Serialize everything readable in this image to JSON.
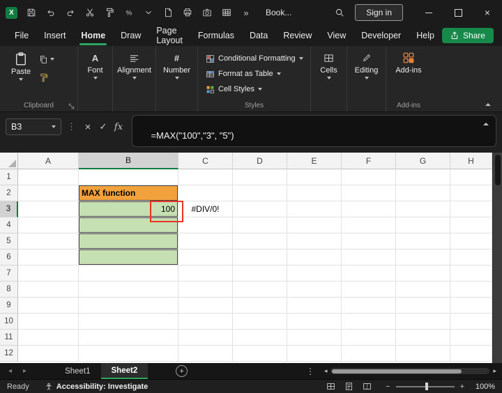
{
  "colors": {
    "accent_green": "#2EA561",
    "brand_green": "#107C41",
    "annotation_red": "#EA3323",
    "cell_orange": "#F2A23C",
    "cell_green": "#C6E0B4",
    "header_highlight": "#D2D2D2"
  },
  "titlebar": {
    "document_name": "Book...",
    "sign_in_label": "Sign in",
    "quick_access_icons": [
      "save",
      "undo",
      "redo",
      "cut",
      "format-painter",
      "percent",
      "chevron-down",
      "new-document",
      "print",
      "camera",
      "table",
      "overflow"
    ]
  },
  "menubar": {
    "items": [
      "File",
      "Insert",
      "Home",
      "Draw",
      "Page Layout",
      "Formulas",
      "Data",
      "Review",
      "View",
      "Developer",
      "Help"
    ],
    "active_item": "Home",
    "share_label": "Share"
  },
  "ribbon": {
    "paste_label": "Paste",
    "clipboard_group_label": "Clipboard",
    "font_label": "Font",
    "alignment_label": "Alignment",
    "number_label": "Number",
    "conditional_formatting_label": "Conditional Formatting",
    "format_as_table_label": "Format as Table",
    "cell_styles_label": "Cell Styles",
    "styles_group_label": "Styles",
    "cells_label": "Cells",
    "editing_label": "Editing",
    "addins_label": "Add-ins",
    "addins_group_label": "Add-ins"
  },
  "formula_bar": {
    "name_box_value": "B3",
    "formula": "=MAX(\"100\",\"3\", \"5\")"
  },
  "grid": {
    "columns": [
      "A",
      "B",
      "C",
      "D",
      "E",
      "F",
      "G",
      "H"
    ],
    "row_count": 12,
    "highlight_column": "B",
    "highlight_row": 3,
    "cells": {
      "B2": {
        "value": "MAX function",
        "bg": "#F2A23C",
        "bold": true,
        "bordered": true
      },
      "B3": {
        "value": "100",
        "bg": "#C6E0B4",
        "align": "right",
        "bordered": true
      },
      "B4": {
        "bg": "#C6E0B4",
        "bordered": true
      },
      "B5": {
        "bg": "#C6E0B4",
        "bordered": true
      },
      "B6": {
        "bg": "#C6E0B4",
        "bordered": true
      },
      "C3": {
        "value": "#DIV/0!",
        "align": "center"
      }
    }
  },
  "sheet_tabs": {
    "tabs": [
      "Sheet1",
      "Sheet2"
    ],
    "active_tab": "Sheet2"
  },
  "status_bar": {
    "mode_label": "Ready",
    "accessibility_label": "Accessibility: Investigate",
    "zoom_value": "100%"
  }
}
